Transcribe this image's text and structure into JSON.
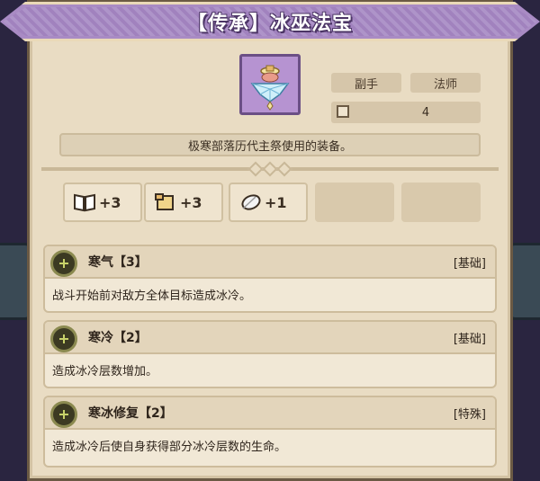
{
  "item": {
    "title": "【传承】冰巫法宝",
    "icon": "ice-gourd-icon",
    "tags": [
      "副手",
      "法师"
    ],
    "stat_value": "4",
    "description": "极寒部落历代主祭使用的装备。"
  },
  "bonuses": [
    {
      "icon": "book-icon",
      "value": "+3"
    },
    {
      "icon": "scroll-icon",
      "value": "+3"
    },
    {
      "icon": "feather-icon",
      "value": "+1"
    }
  ],
  "skills": [
    {
      "name": "寒气【3】",
      "type": "[基础]",
      "desc": "战斗开始前对敌方全体目标造成冰冷。"
    },
    {
      "name": "寒冷【2】",
      "type": "[基础]",
      "desc": "造成冰冷层数增加。"
    },
    {
      "name": "寒冰修复【2】",
      "type": "[特殊]",
      "desc": "造成冰冷后使自身获得部分冰冷层数的生命。"
    }
  ]
}
